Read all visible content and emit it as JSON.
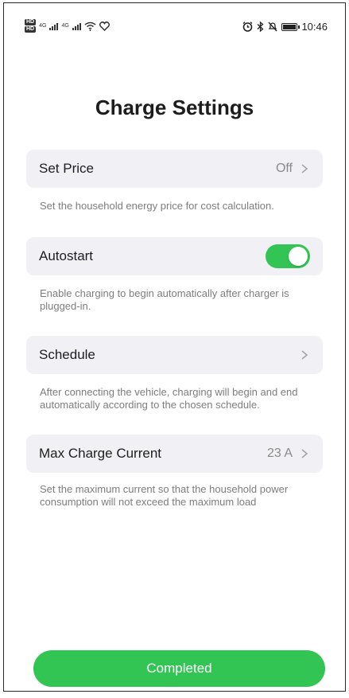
{
  "status_bar": {
    "hd1": "HD",
    "hd2": "HD",
    "net1": "4G",
    "net2": "4G",
    "time": "10:46"
  },
  "page": {
    "title": "Charge Settings"
  },
  "settings": {
    "set_price": {
      "label": "Set Price",
      "value": "Off",
      "description": "Set the household energy price for cost calculation."
    },
    "autostart": {
      "label": "Autostart",
      "enabled": true,
      "description": "Enable charging to begin automatically after charger is plugged-in."
    },
    "schedule": {
      "label": "Schedule",
      "description": "After connecting the vehicle, charging will begin and end automatically according to the chosen schedule."
    },
    "max_current": {
      "label": "Max Charge Current",
      "value": "23 A",
      "description": "Set the maximum current so that the household power consumption will not exceed the maximum load"
    }
  },
  "footer": {
    "complete_label": "Completed"
  },
  "colors": {
    "accent": "#32c553",
    "card_bg": "#f1f1f5",
    "muted_text": "#7d7d7d"
  }
}
